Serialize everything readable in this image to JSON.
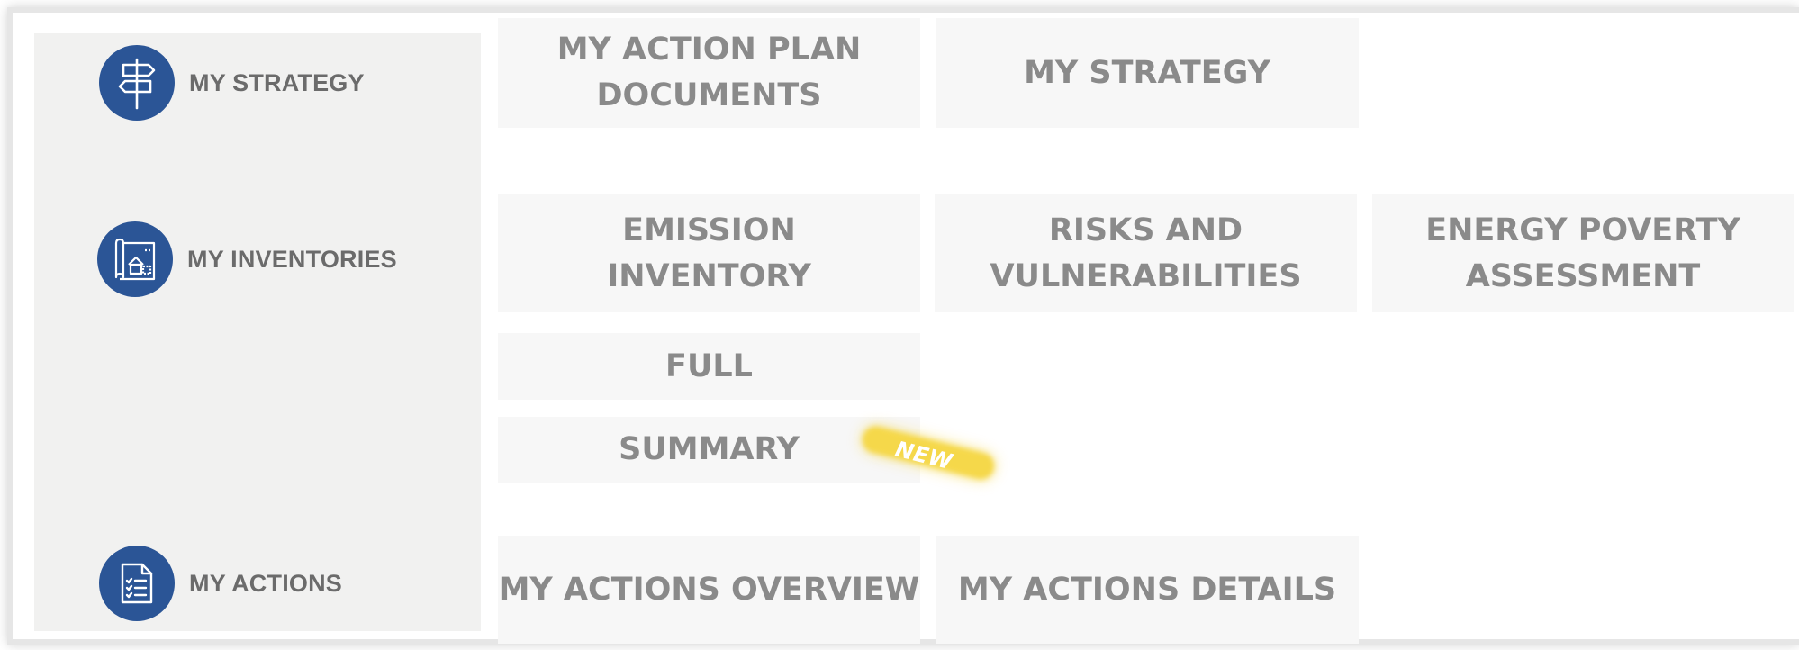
{
  "colors": {
    "icon_circle": "#2b5596",
    "sidebar_bg": "#f1f1f0",
    "tile_bg": "#f7f7f7",
    "tile_text": "#8a8a8a",
    "section_text": "#6b6b6b",
    "badge": "#f5d84a"
  },
  "sections": {
    "strategy": {
      "label": "MY STRATEGY",
      "icon": "signpost-icon"
    },
    "inventories": {
      "label": "MY INVENTORIES",
      "icon": "blueprint-icon"
    },
    "actions": {
      "label": "MY ACTIONS",
      "icon": "checklist-icon"
    }
  },
  "tiles": {
    "action_plan_documents": "MY ACTION PLAN\nDOCUMENTS",
    "my_strategy": "MY STRATEGY",
    "emission_inventory": "EMISSION\nINVENTORY",
    "risks_vulnerabilities": "RISKS AND\nVULNERABILITIES",
    "energy_poverty": "ENERGY POVERTY\nASSESSMENT",
    "full": "FULL",
    "summary": "SUMMARY",
    "actions_overview": "MY ACTIONS OVERVIEW",
    "actions_details": "MY ACTIONS DETAILS"
  },
  "badge": {
    "label": "NEW"
  }
}
